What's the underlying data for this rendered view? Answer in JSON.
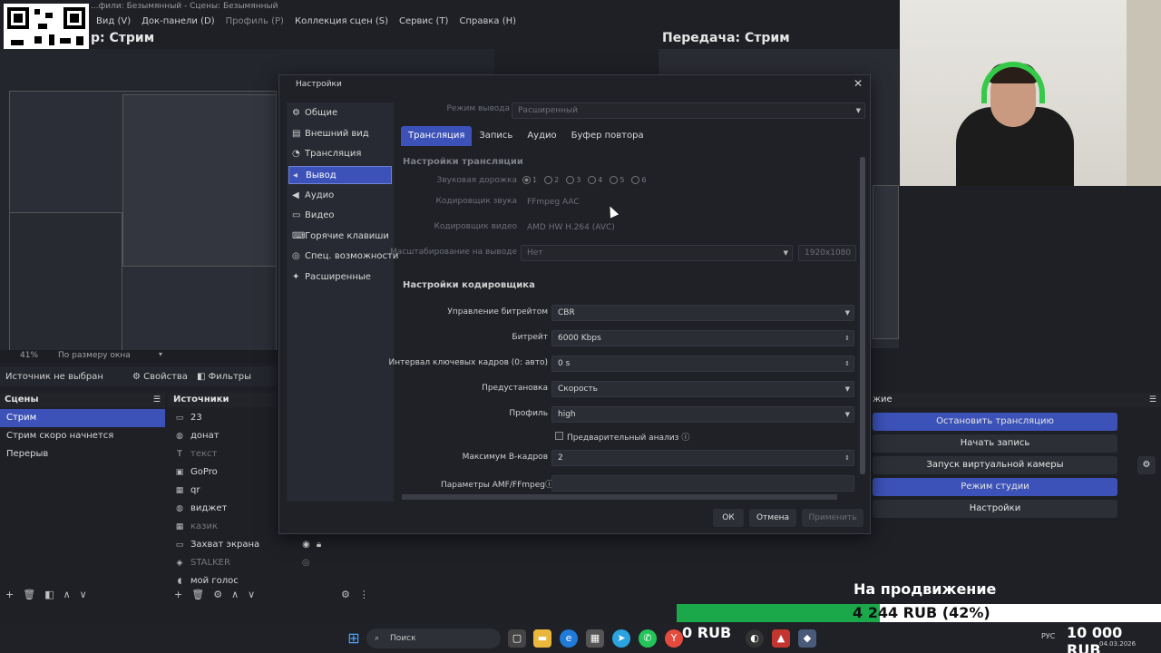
{
  "window": {
    "title": "...фили: Безымянный - Сцены: Безымянный",
    "menu": [
      "Вид (V)",
      "Док-панели (D)",
      "Профиль (P)",
      "Коллекция сцен (S)",
      "Сервис (T)",
      "Справка (H)"
    ]
  },
  "preview": {
    "left_title": "р: Стрим",
    "right_title": "Передача: Стрим",
    "zoom": "41%",
    "zoom_mode": "По размеру окна"
  },
  "source_bar": {
    "status": "Источник не выбран",
    "properties": "Свойства",
    "filters": "Фильтры"
  },
  "scenes": {
    "header": "Сцены",
    "items": [
      "Стрим",
      "Стрим скоро начнется",
      "Перерыв"
    ],
    "selected": 0
  },
  "sources": {
    "header": "Источники",
    "items": [
      {
        "name": "23",
        "icon": "monitor-icon",
        "dim": false
      },
      {
        "name": "донат",
        "icon": "globe-icon",
        "dim": false
      },
      {
        "name": "текст",
        "icon": "text-icon",
        "dim": true
      },
      {
        "name": "GoPro",
        "icon": "camera-icon",
        "dim": false
      },
      {
        "name": "qr",
        "icon": "image-icon",
        "dim": false
      },
      {
        "name": "виджет",
        "icon": "globe-icon",
        "dim": false
      },
      {
        "name": "казик",
        "icon": "image-icon",
        "dim": true
      },
      {
        "name": "Захват экрана",
        "icon": "monitor-icon",
        "dim": false
      },
      {
        "name": "STALKER",
        "icon": "game-icon",
        "dim": true
      },
      {
        "name": "мой голос",
        "icon": "mic-icon",
        "dim": false
      }
    ]
  },
  "controls": {
    "header": "жие",
    "buttons": [
      "Остановить трансляцию",
      "Начать запись",
      "Запуск виртуальной камеры",
      "Режим студии",
      "Настройки"
    ]
  },
  "settings_dialog": {
    "title": "Настройки",
    "sidebar": [
      "Общие",
      "Внешний вид",
      "Трансляция",
      "Вывод",
      "Аудио",
      "Видео",
      "Горячие клавиши",
      "Спец. возможности",
      "Расширенные"
    ],
    "selected": 3,
    "output_mode_label": "Режим вывода",
    "output_mode_value": "Расширенный",
    "tabs": [
      "Трансляция",
      "Запись",
      "Аудио",
      "Буфер повтора"
    ],
    "stream_section": "Настройки трансляции",
    "audio_track_label": "Звуковая дорожка",
    "audio_tracks": [
      "1",
      "2",
      "3",
      "4",
      "5",
      "6"
    ],
    "audio_encoder_label": "Кодировщик звука",
    "audio_encoder_value": "FFmpeg AAC",
    "video_encoder_label": "Кодировщик видео",
    "video_encoder_value": "AMD HW H.264 (AVC)",
    "rescale_label": "Масштабирование на выводе",
    "rescale_value": "Нет",
    "rescale_res": "1920x1080",
    "encoder_section": "Настройки кодировщика",
    "bitrate_control_label": "Управление битрейтом",
    "bitrate_control_value": "CBR",
    "bitrate_label": "Битрейт",
    "bitrate_value": "6000 Kbps",
    "keyframe_label": "Интервал ключевых кадров (0: авто)",
    "keyframe_value": "0 s",
    "preset_label": "Предустановка",
    "preset_value": "Скорость",
    "profile_label": "Профиль",
    "profile_value": "high",
    "lookahead_label": "Предварительный анализ",
    "bframes_label": "Максимум В-кадров",
    "bframes_value": "2",
    "amf_label": "Параметры AMF/FFmpeg",
    "ok": "ОК",
    "cancel": "Отмена",
    "apply": "Применить"
  },
  "promo": {
    "title": "На продвижение",
    "amount": "4 244 RUB (42%)",
    "progress": 0.42,
    "left": "0 RUB",
    "right": "10 000 RUB"
  },
  "taskbar": {
    "search_placeholder": "Поиск",
    "lang": "РУС",
    "date": "04.03.2026"
  },
  "colors": {
    "accent": "#3c52b8",
    "bg": "#1e2026",
    "promo_green": "#1aa84a"
  }
}
